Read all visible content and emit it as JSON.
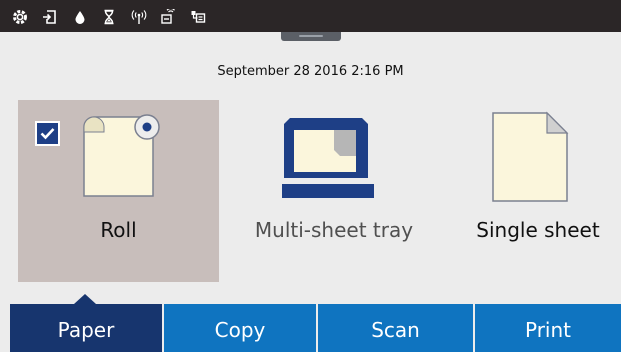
{
  "status_bar": {
    "icons": [
      "gear-icon",
      "paper-in-icon",
      "ink-drop-icon",
      "hourglass-icon",
      "wireless-signal-icon",
      "wifi-direct-icon",
      "network-printer-icon"
    ]
  },
  "datetime": "September 28 2016 2:16 PM",
  "paper_options": [
    {
      "label": "Roll",
      "selected": true,
      "enabled": true
    },
    {
      "label": "Multi-sheet tray",
      "selected": false,
      "enabled": false
    },
    {
      "label": "Single sheet",
      "selected": false,
      "enabled": true
    }
  ],
  "tabs": [
    {
      "label": "Paper",
      "active": true
    },
    {
      "label": "Copy",
      "active": false
    },
    {
      "label": "Scan",
      "active": false
    },
    {
      "label": "Print",
      "active": false
    }
  ],
  "colors": {
    "status_bar": "#2b2627",
    "selected_option": "#c8bebb",
    "tab_active": "#17356e",
    "tab_inactive": "#0f74c0",
    "paper": "#fbf6dc"
  }
}
